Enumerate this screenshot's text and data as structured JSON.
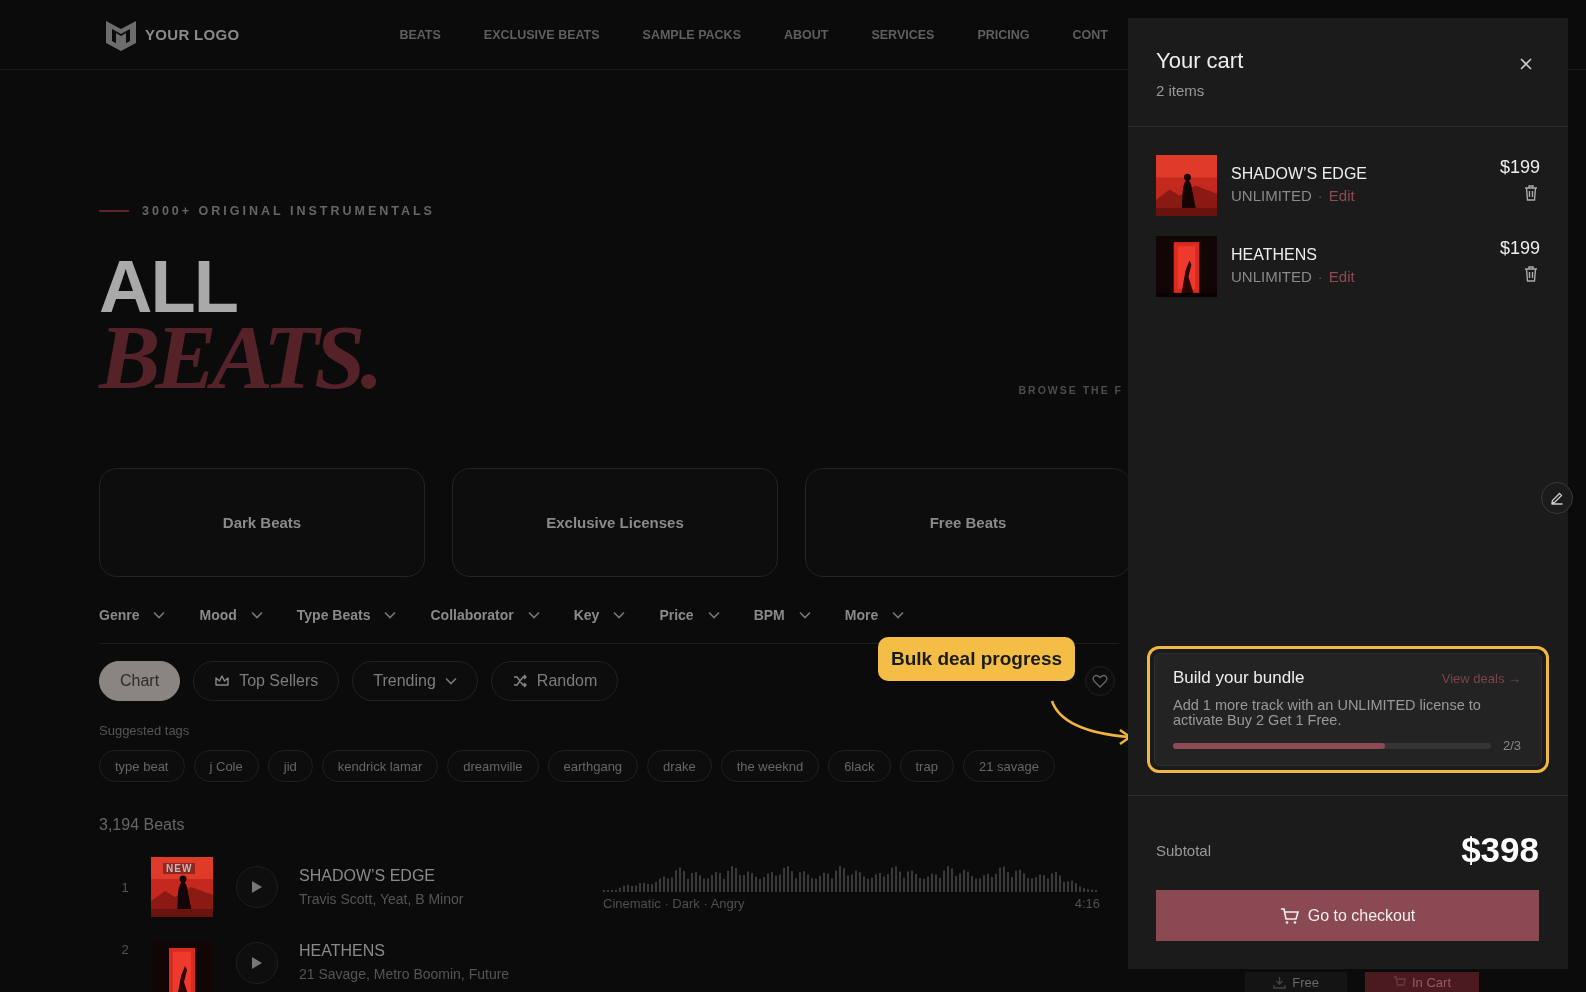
{
  "nav": {
    "logo": "YOUR LOGO",
    "links": [
      "BEATS",
      "EXCLUSIVE BEATS",
      "SAMPLE PACKS",
      "ABOUT",
      "SERVICES",
      "PRICING",
      "CONT"
    ]
  },
  "hero": {
    "eyebrow": "3000+ ORIGINAL INSTRUMENTALS",
    "title_line_1": "ALL",
    "title_line_2": "BEATS.",
    "side_note": "BROWSE THE F"
  },
  "categories": [
    "Dark Beats",
    "Exclusive Licenses",
    "Free Beats"
  ],
  "filters": [
    "Genre",
    "Mood",
    "Type Beats",
    "Collaborator",
    "Key",
    "Price",
    "BPM",
    "More"
  ],
  "sort_options": [
    {
      "label": "Chart",
      "kind": "plain",
      "selected": true
    },
    {
      "label": "Top Sellers",
      "kind": "crown",
      "selected": false
    },
    {
      "label": "Trending",
      "kind": "dropdown",
      "selected": false
    },
    {
      "label": "Random",
      "kind": "shuffle",
      "selected": false
    }
  ],
  "suggested_tags": {
    "label": "Suggested tags",
    "tags": [
      "type beat",
      "j Cole",
      "jid",
      "kendrick lamar",
      "dreamville",
      "earthgang",
      "drake",
      "the weeknd",
      "6lack",
      "trap",
      "21 savage"
    ]
  },
  "results_count": "3,194 Beats",
  "tracks": [
    {
      "rank": "1",
      "badge": "NEW",
      "title": "SHADOW’S EDGE",
      "artists": "Travis Scott, Yeat, B Minor",
      "tags": "Cinematic · Dark · Angry",
      "duration": "4:16"
    },
    {
      "rank": "2",
      "title": "HEATHENS",
      "artists": "21 Savage, Metro Boomin, Future",
      "free_label": "Free",
      "cart_label": "In Cart",
      "in_cart": true
    }
  ],
  "callout": "Bulk deal progress",
  "cart": {
    "title": "Your cart",
    "count": "2 items",
    "items": [
      {
        "title": "SHADOW’S EDGE",
        "license": "UNLIMITED",
        "separator": "·",
        "edit": "Edit",
        "price": "$199"
      },
      {
        "title": "HEATHENS",
        "license": "UNLIMITED",
        "separator": "·",
        "edit": "Edit",
        "price": "$199"
      }
    ],
    "bundle": {
      "title": "Build your bundle",
      "link": "View deals →",
      "message": "Add 1 more track with an UNLIMITED license to activate Buy 2 Get 1 Free.",
      "level": 0.667,
      "progress": "2/3"
    },
    "subtotal_label": "Subtotal",
    "subtotal": "$398",
    "checkout": "Go to checkout"
  }
}
